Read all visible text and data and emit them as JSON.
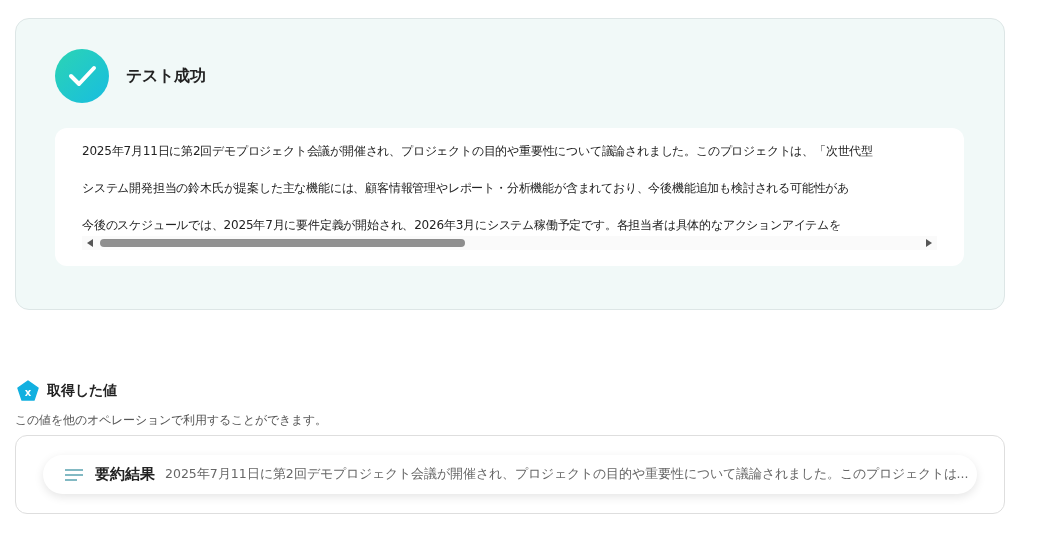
{
  "result": {
    "title": "テスト成功",
    "lines": [
      "2025年7月11日に第2回デモプロジェクト会議が開催され、プロジェクトの目的や重要性について議論されました。このプロジェクトは、「次世代型",
      "システム開発担当の鈴木氏が提案した主な機能には、顧客情報管理やレポート・分析機能が含まれており、今後機能追加も検討される可能性があ",
      "今後のスケジュールでは、2025年7月に要件定義が開始され、2026年3月にシステム稼働予定です。各担当者は具体的なアクションアイテムを"
    ]
  },
  "values": {
    "title": "取得した値",
    "icon": "x",
    "description": "この値を他のオペレーションで利用することができます。",
    "items": [
      {
        "label": "要約結果",
        "value": "2025年7月11日に第2回デモプロジェクト会議が開催され、プロジェクトの目的や重要性について議論されました。このプロジェクトは..."
      }
    ]
  }
}
